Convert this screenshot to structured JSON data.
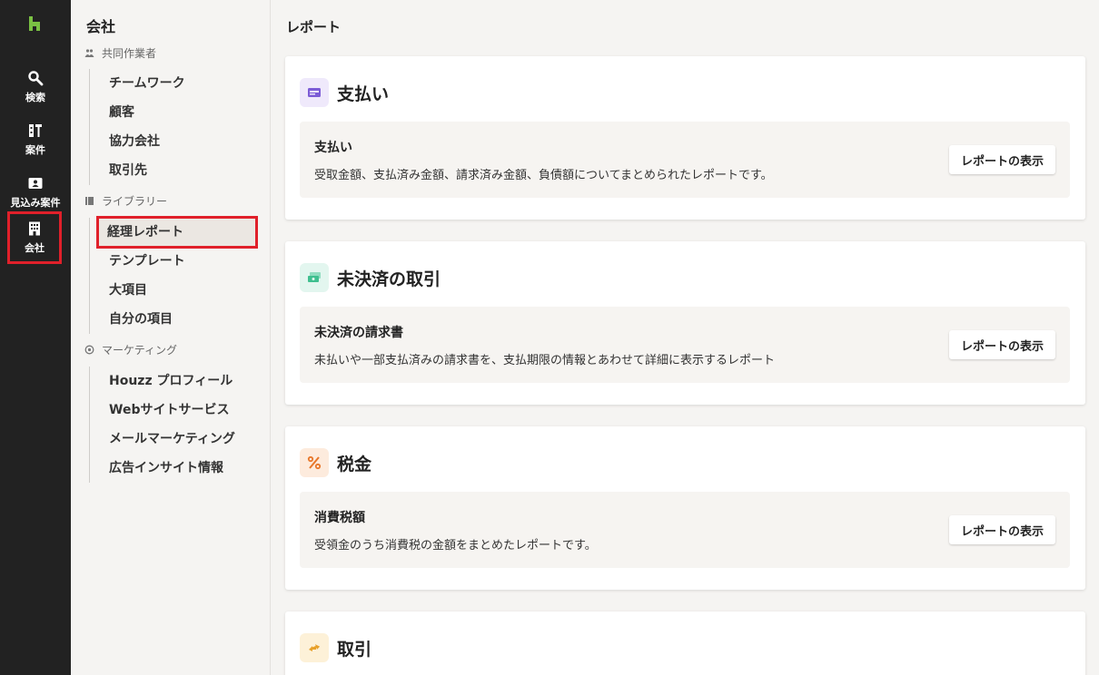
{
  "rail": {
    "items": [
      {
        "label": "検索",
        "icon": "search-icon"
      },
      {
        "label": "案件",
        "icon": "projects-icon"
      },
      {
        "label": "見込み案件",
        "icon": "leads-icon"
      },
      {
        "label": "会社",
        "icon": "building-icon"
      }
    ]
  },
  "subnav": {
    "title": "会社",
    "sections": [
      {
        "label": "共同作業者",
        "items": [
          "チームワーク",
          "顧客",
          "協力会社",
          "取引先"
        ]
      },
      {
        "label": "ライブラリー",
        "items": [
          "経理レポート",
          "テンプレート",
          "大項目",
          "自分の項目"
        ]
      },
      {
        "label": "マーケティング",
        "items": [
          "Houzz プロフィール",
          "Webサイトサービス",
          "メールマーケティング",
          "広告インサイト情報"
        ]
      }
    ]
  },
  "main": {
    "title": "レポート",
    "cards": [
      {
        "title": "支払い",
        "icon": "wallet-icon",
        "icon_bg": "#efe9fb",
        "icon_color": "#7c5cd6",
        "row": {
          "title": "支払い",
          "desc": "受取金額、支払済み金額、請求済み金額、負債額についてまとめられたレポートです。",
          "button": "レポートの表示"
        }
      },
      {
        "title": "未決済の取引",
        "icon": "money-stack-icon",
        "icon_bg": "#e3f6ef",
        "icon_color": "#3fbf8f",
        "row": {
          "title": "未決済の請求書",
          "desc": "未払いや一部支払済みの請求書を、支払期限の情報とあわせて詳細に表示するレポート",
          "button": "レポートの表示"
        }
      },
      {
        "title": "税金",
        "icon": "percent-icon",
        "icon_bg": "#fdebdd",
        "icon_color": "#e8772a",
        "row": {
          "title": "消費税額",
          "desc": "受領金のうち消費税の金額をまとめたレポートです。",
          "button": "レポートの表示"
        }
      },
      {
        "title": "取引",
        "icon": "exchange-icon",
        "icon_bg": "#fdf1d8",
        "icon_color": "#e8a12a"
      }
    ]
  },
  "colors": {
    "rail_bg": "#222222",
    "brand_green": "#7ac143",
    "highlight_red": "#e0202a"
  }
}
